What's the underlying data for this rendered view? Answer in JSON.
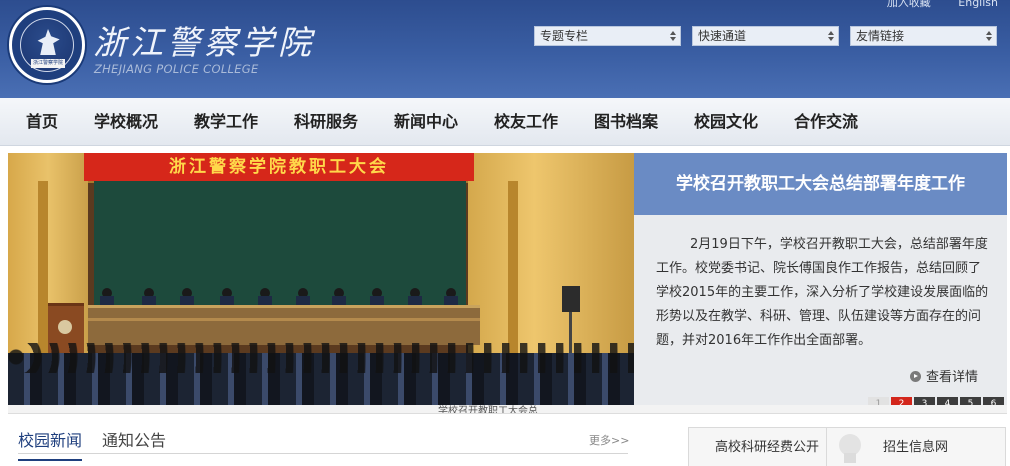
{
  "header": {
    "logo_band_text": "浙江警察学院",
    "brand_cn": "浙江警察学院",
    "brand_en": "ZHEJIANG POLICE COLLEGE",
    "top_links": [
      "加入收藏",
      "English"
    ],
    "selects": [
      {
        "label": "专题专栏"
      },
      {
        "label": "快速通道"
      },
      {
        "label": "友情链接"
      }
    ]
  },
  "nav": {
    "items": [
      "首页",
      "学校概况",
      "教学工作",
      "科研服务",
      "新闻中心",
      "校友工作",
      "图书档案",
      "校园文化",
      "合作交流"
    ]
  },
  "banner": {
    "stage_banner_text": "浙江警察学院教职工大会"
  },
  "feature": {
    "title": "学校召开教职工大会总结部署年度工作",
    "body": "2月19日下午，学校召开教职工大会，总结部署年度工作。校党委书记、院长傅国良作工作报告，总结回顾了学校2015年的主要工作，深入分析了学校建设发展面临的形势以及在教学、科研、管理、队伍建设等方面存在的问题，并对2016年工作作出全面部署。",
    "more_label": "查看详情",
    "pager": [
      "1",
      "2",
      "3",
      "4",
      "5",
      "6"
    ],
    "pager_active": "2"
  },
  "strip": {
    "caption": "学校召开教职工大会总"
  },
  "news": {
    "tabs": [
      "校园新闻",
      "通知公告"
    ],
    "more_label": "更多>>"
  },
  "quick_links": [
    "高校科研经费公开",
    "招生信息网"
  ],
  "colors": {
    "header_blue": "#3a5ea3",
    "feature_title_bg": "#6a8bc4",
    "pager_active": "#d3261b",
    "tab_active": "#1f3f7e"
  }
}
